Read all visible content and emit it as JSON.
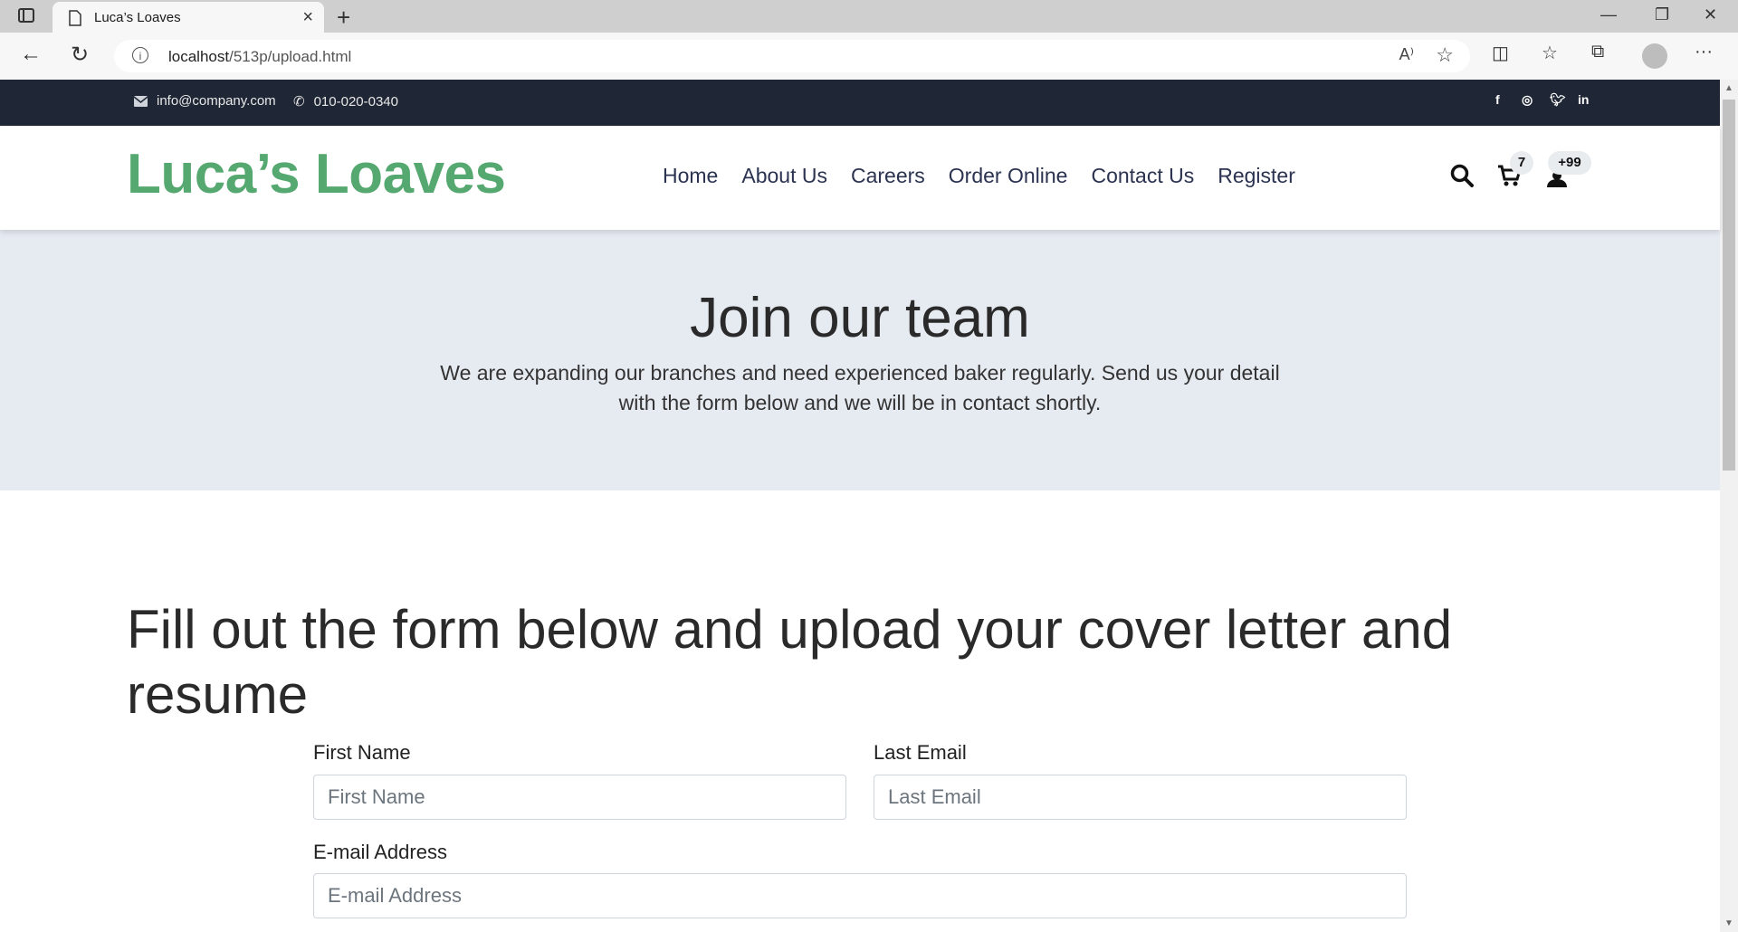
{
  "browser": {
    "tab_title": "Luca’s Loaves",
    "url_host": "localhost",
    "url_path": "/513p/upload.html"
  },
  "topbar": {
    "email": "info@company.com",
    "phone": "010-020-0340",
    "social": [
      "facebook-icon",
      "instagram-icon",
      "twitter-icon",
      "linkedin-icon"
    ]
  },
  "header": {
    "logo": "Luca’s Loaves",
    "nav": [
      "Home",
      "About Us",
      "Careers",
      "Order Online",
      "Contact Us",
      "Register"
    ],
    "cart_count": "7",
    "user_count": "+99"
  },
  "hero": {
    "title": "Join our team",
    "text": "We are expanding our branches and need experienced baker regularly. Send us your detail with the form below and we will be in contact shortly."
  },
  "form": {
    "title": "Fill out the form below and upload your cover letter and resume",
    "first_name_label": "First Name",
    "first_name_placeholder": "First Name",
    "last_email_label": "Last Email",
    "last_email_placeholder": "Last Email",
    "email_label": "E-mail Address",
    "email_placeholder": "E-mail Address"
  },
  "colors": {
    "brand_green": "#55a86f",
    "topbar_bg": "#1f2635",
    "hero_bg": "#e6eaf1"
  }
}
